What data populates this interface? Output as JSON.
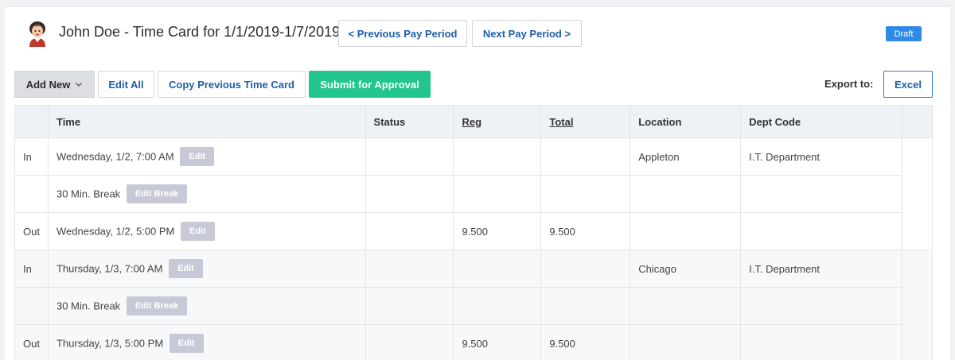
{
  "header": {
    "title": "John Doe - Time Card for 1/1/2019-1/7/2019",
    "prev_label": "< Previous Pay Period",
    "next_label": "Next Pay Period >",
    "status_badge": "Draft"
  },
  "toolbar": {
    "add_new_label": "Add New",
    "edit_all_label": "Edit All",
    "copy_label": "Copy Previous Time Card",
    "submit_label": "Submit for Approval",
    "export_label": "Export to:",
    "excel_label": "Excel"
  },
  "table": {
    "columns": [
      "",
      "Time",
      "Status",
      "Reg",
      "Total",
      "Location",
      "Dept Code",
      ""
    ],
    "rows": [
      {
        "side": "In",
        "time": "Wednesday, 1/2, 7:00 AM",
        "action": "Edit",
        "status": "",
        "reg": "",
        "total": "",
        "location": "Appleton",
        "dept": "I.T. Department"
      },
      {
        "side": "",
        "time": "30 Min. Break",
        "action": "Edit Break",
        "status": "",
        "reg": "",
        "total": "",
        "location": "",
        "dept": ""
      },
      {
        "side": "Out",
        "time": "Wednesday, 1/2, 5:00 PM",
        "action": "Edit",
        "status": "",
        "reg": "9.500",
        "total": "9.500",
        "location": "",
        "dept": ""
      },
      {
        "side": "In",
        "time": "Thursday, 1/3, 7:00 AM",
        "action": "Edit",
        "status": "",
        "reg": "",
        "total": "",
        "location": "Chicago",
        "dept": "I.T. Department"
      },
      {
        "side": "",
        "time": "30 Min. Break",
        "action": "Edit Break",
        "status": "",
        "reg": "",
        "total": "",
        "location": "",
        "dept": ""
      },
      {
        "side": "Out",
        "time": "Thursday, 1/3, 5:00 PM",
        "action": "Edit",
        "status": "",
        "reg": "9.500",
        "total": "9.500",
        "location": "",
        "dept": ""
      }
    ]
  },
  "colors": {
    "primary_text": "#1f5fa8",
    "submit_green": "#22c58b",
    "draft_blue": "#2e8ae6",
    "edit_gray": "#c7c9d6"
  }
}
